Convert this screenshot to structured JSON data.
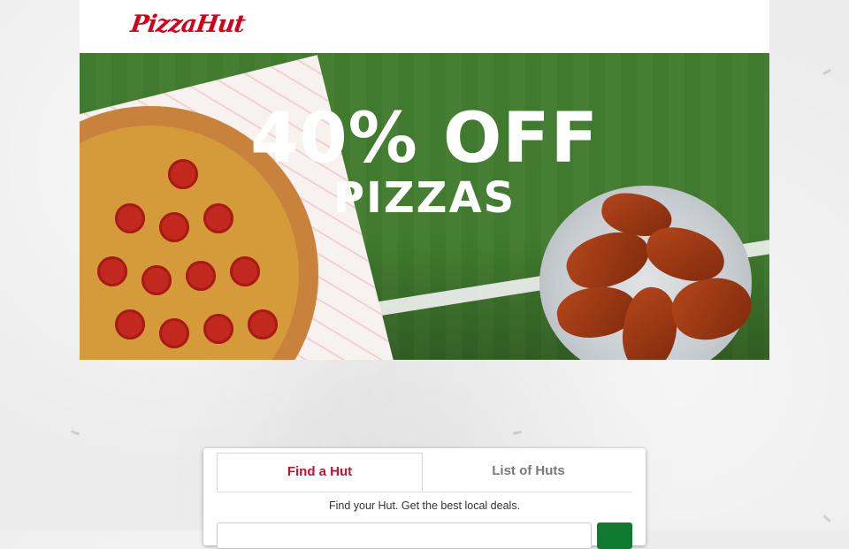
{
  "header": {
    "logo_text": "PizzaHut"
  },
  "hero": {
    "headline": "40% OFF",
    "subline": "PIZZAS"
  },
  "finder": {
    "tabs": [
      {
        "label": "Find a Hut",
        "active": true
      },
      {
        "label": "List of Huts",
        "active": false
      }
    ],
    "description": "Find your Hut. Get the best local deals.",
    "search_placeholder": ""
  },
  "colors": {
    "brand_red": "#c8102e",
    "action_green": "#107a31",
    "field_green": "#3f7a2e"
  }
}
